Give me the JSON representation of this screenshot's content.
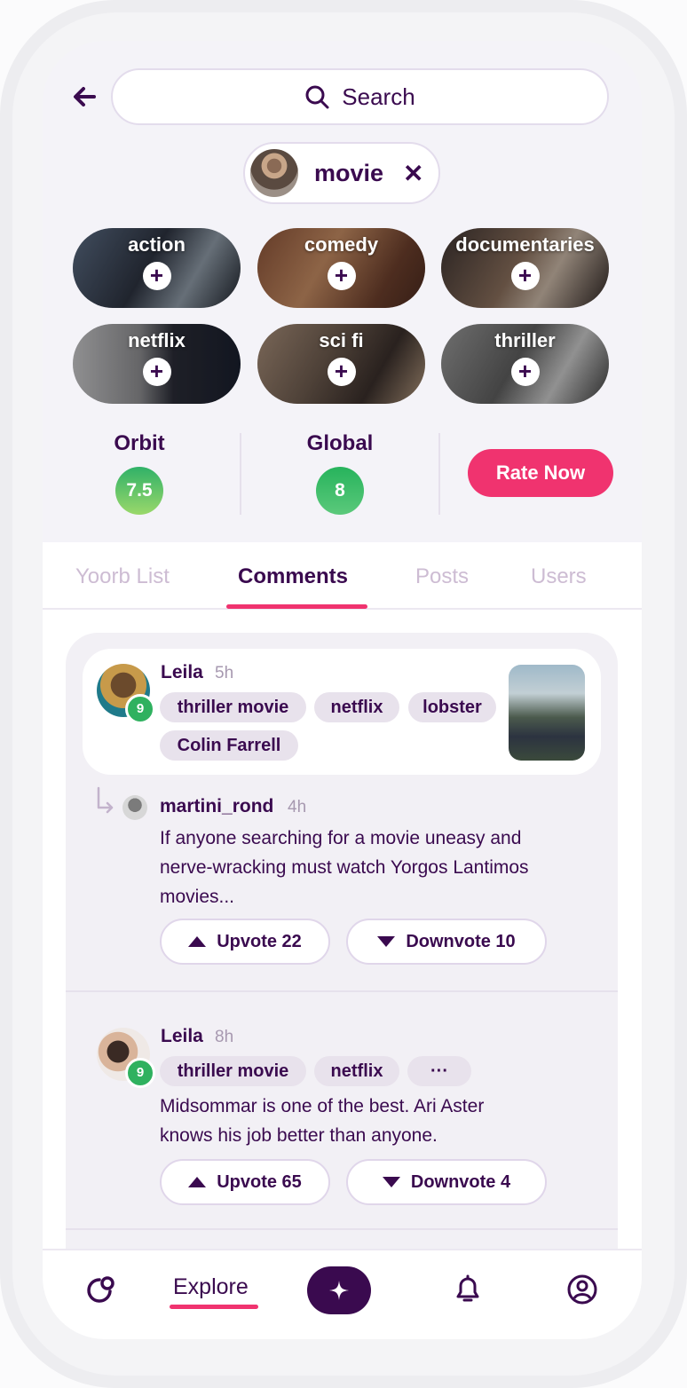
{
  "search": {
    "placeholder": "Search"
  },
  "topic": {
    "label": "movie"
  },
  "categories": [
    {
      "label": "action"
    },
    {
      "label": "comedy"
    },
    {
      "label": "documentaries"
    },
    {
      "label": "netflix"
    },
    {
      "label": "sci fi"
    },
    {
      "label": "thriller"
    }
  ],
  "ratings": {
    "orbit_label": "Orbit",
    "orbit_value": "7.5",
    "global_label": "Global",
    "global_value": "8",
    "rate_now": "Rate Now"
  },
  "tabs": [
    "Yoorb List",
    "Comments",
    "Posts",
    "Users"
  ],
  "comments": [
    {
      "user": "Leila",
      "time": "5h",
      "level": "9",
      "tags": [
        "thriller movie",
        "netflix",
        "lobster",
        "Colin Farrell"
      ],
      "reply": {
        "user": "martini_rond",
        "time": "4h",
        "text_line1": "If anyone searching for a movie uneasy and",
        "text_line2": "nerve-wracking must watch Yorgos Lantimos",
        "text_line3": "movies...",
        "upvote": "Upvote 22",
        "downvote": "Downvote 10"
      }
    },
    {
      "user": "Leila",
      "time": "8h",
      "level": "9",
      "tags": [
        "thriller movie",
        "netflix",
        "···"
      ],
      "text_line1": "Midsommar is one of the best. Ari Aster",
      "text_line2": "knows his job better than anyone.",
      "upvote": "Upvote 65",
      "downvote": "Downvote 4"
    }
  ],
  "nav": {
    "explore": "Explore"
  },
  "colors": {
    "primary": "#3a0a4f",
    "accent": "#f0336f",
    "green": "#2fb15f"
  }
}
